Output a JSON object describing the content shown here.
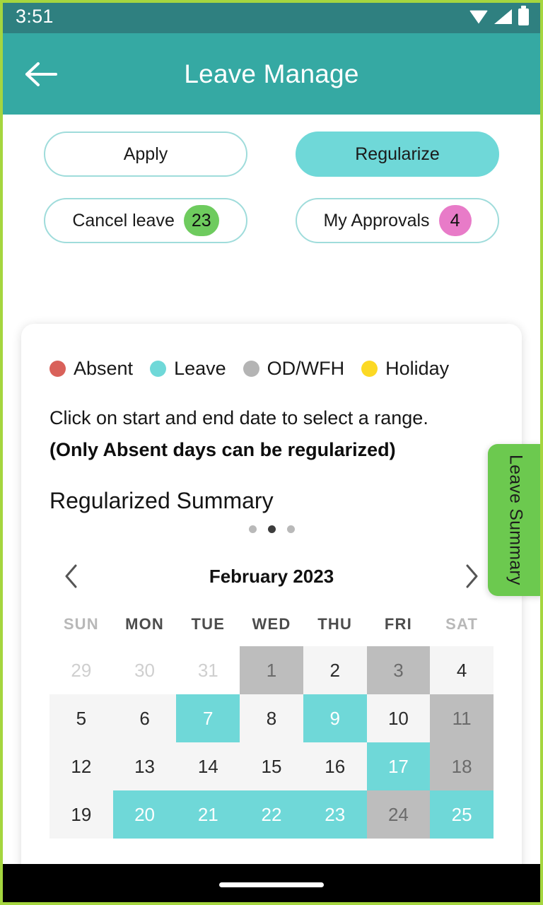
{
  "status_bar": {
    "time": "3:51",
    "icons": [
      "wifi-icon",
      "signal-icon",
      "battery-icon"
    ]
  },
  "app_bar": {
    "title": "Leave Manage",
    "back_icon": "back-arrow-icon",
    "background": "#35a9a3"
  },
  "actions": {
    "apply": {
      "label": "Apply",
      "selected": false
    },
    "regularize": {
      "label": "Regularize",
      "selected": true
    },
    "cancel_leave": {
      "label": "Cancel leave",
      "badge": "23",
      "badge_color": "#6ecb5e"
    },
    "my_approvals": {
      "label": "My Approvals",
      "badge": "4",
      "badge_color": "#e87bc8"
    }
  },
  "legend": [
    {
      "label": "Absent",
      "color": "#d9615a"
    },
    {
      "label": "Leave",
      "color": "#6fd8d8"
    },
    {
      "label": "OD/WFH",
      "color": "#b4b4b4"
    },
    {
      "label": "Holiday",
      "color": "#fcd924"
    }
  ],
  "hint": {
    "line1": "Click on start and end date to select a range.",
    "line2": "(Only Absent days can be regularized)"
  },
  "summary": {
    "title": "Regularized Summary",
    "pager": {
      "count": 3,
      "active_index": 1
    }
  },
  "calendar": {
    "prev_icon": "chevron-left-icon",
    "next_icon": "chevron-right-icon",
    "month_label": "February 2023",
    "day_headers": [
      "SUN",
      "MON",
      "TUE",
      "WED",
      "THU",
      "FRI",
      "SAT"
    ],
    "weeks": [
      [
        {
          "day": "29",
          "state": "muted"
        },
        {
          "day": "30",
          "state": "muted"
        },
        {
          "day": "31",
          "state": "muted"
        },
        {
          "day": "1",
          "state": "grey"
        },
        {
          "day": "2",
          "state": "plain"
        },
        {
          "day": "3",
          "state": "grey"
        },
        {
          "day": "4",
          "state": "plain"
        }
      ],
      [
        {
          "day": "5",
          "state": "plain"
        },
        {
          "day": "6",
          "state": "plain"
        },
        {
          "day": "7",
          "state": "leave"
        },
        {
          "day": "8",
          "state": "plain"
        },
        {
          "day": "9",
          "state": "leave"
        },
        {
          "day": "10",
          "state": "plain"
        },
        {
          "day": "11",
          "state": "grey"
        }
      ],
      [
        {
          "day": "12",
          "state": "plain"
        },
        {
          "day": "13",
          "state": "plain"
        },
        {
          "day": "14",
          "state": "plain"
        },
        {
          "day": "15",
          "state": "plain"
        },
        {
          "day": "16",
          "state": "plain"
        },
        {
          "day": "17",
          "state": "leave"
        },
        {
          "day": "18",
          "state": "grey"
        }
      ],
      [
        {
          "day": "19",
          "state": "plain"
        },
        {
          "day": "20",
          "state": "leave"
        },
        {
          "day": "21",
          "state": "leave"
        },
        {
          "day": "22",
          "state": "leave"
        },
        {
          "day": "23",
          "state": "leave"
        },
        {
          "day": "24",
          "state": "grey"
        },
        {
          "day": "25",
          "state": "leave"
        }
      ]
    ]
  },
  "side_tab": {
    "label": "Leave Summary",
    "color": "#6cc94f"
  }
}
